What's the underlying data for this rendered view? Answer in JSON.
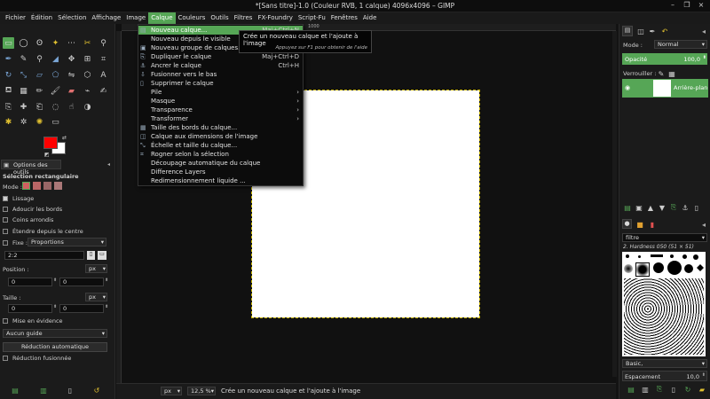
{
  "window": {
    "title": "*[Sans titre]-1.0 (Couleur RVB, 1 calque) 4096x4096 – GIMP",
    "min_glyph": "–",
    "max_glyph": "❐",
    "close_glyph": "×"
  },
  "menubar": [
    "Fichier",
    "Édition",
    "Sélection",
    "Affichage",
    "Image",
    "Calque",
    "Couleurs",
    "Outils",
    "Filtres",
    "FX-Foundry",
    "Script-Fu",
    "Fenêtres",
    "Aide"
  ],
  "menubar_active": "Calque",
  "layer_menu": {
    "items": [
      {
        "label": "Nouveau calque...",
        "shortcut": "Maj+Ctrl+N",
        "icon": "new-layer-icon",
        "highlighted": true
      },
      {
        "label": "Nouveau depuis le visible",
        "shortcut": "",
        "icon": ""
      },
      {
        "label": "Nouveau groupe de calques...",
        "shortcut": "",
        "icon": "layer-group-icon"
      },
      {
        "label": "Dupliquer le calque",
        "shortcut": "Maj+Ctrl+D",
        "icon": "duplicate-icon"
      },
      {
        "label": "Ancrer le calque",
        "shortcut": "Ctrl+H",
        "icon": "anchor-icon"
      },
      {
        "label": "Fusionner vers le bas",
        "shortcut": "",
        "icon": "merge-down-icon"
      },
      {
        "label": "Supprimer le calque",
        "shortcut": "",
        "icon": "delete-icon"
      },
      {
        "label": "Pile",
        "shortcut": "›",
        "icon": ""
      },
      {
        "label": "Masque",
        "shortcut": "›",
        "icon": ""
      },
      {
        "label": "Transparence",
        "shortcut": "›",
        "icon": ""
      },
      {
        "label": "Transformer",
        "shortcut": "›",
        "icon": ""
      },
      {
        "label": "Taille des bords du calque...",
        "shortcut": "",
        "icon": "layer-boundary-icon"
      },
      {
        "label": "Calque aux dimensions de l'image",
        "shortcut": "",
        "icon": "layer-to-image-icon"
      },
      {
        "label": "Échelle et taille du calque...",
        "shortcut": "",
        "icon": "scale-icon"
      },
      {
        "label": "Rogner selon la sélection",
        "shortcut": "",
        "icon": "crop-icon"
      },
      {
        "label": "Découpage automatique du calque",
        "shortcut": "",
        "icon": ""
      },
      {
        "label": "Difference Layers",
        "shortcut": "",
        "icon": ""
      },
      {
        "label": "Redimensionnement liquide ...",
        "shortcut": "",
        "icon": ""
      }
    ]
  },
  "tooltip": {
    "text": "Crée un nouveau calque et l'ajoute à l'image",
    "hint": "Appuyez sur F1 pour obtenir de l'aide"
  },
  "tool_options": {
    "tab_label": "Options des outils",
    "title": "Sélection rectangulaire",
    "mode_label": "Mode :",
    "lissage": "Lissage",
    "adoucir": "Adoucir les bords",
    "coins": "Coins arrondis",
    "etendre": "Étendre depuis le centre",
    "fixe_label": "Fixe :",
    "fixe_value": "Proportions",
    "ratio_value": "2:2",
    "position_label": "Position :",
    "position_unit": "px",
    "pos_x": "0",
    "pos_y": "0",
    "taille_label": "Taille :",
    "taille_unit": "px",
    "size_w": "0",
    "size_h": "0",
    "highlight": "Mise en évidence",
    "guide_value": "Aucun guide",
    "auto_shrink": "Réduction automatique",
    "merged": "Réduction fusionnée"
  },
  "layers_panel": {
    "mode_label": "Mode :",
    "mode_value": "Normal",
    "opacity_label": "Opacité",
    "opacity_value": "100,0",
    "lock_label": "Verrouiller :",
    "layer_name": "Arrière-plan"
  },
  "brushes_panel": {
    "filter_label": "filtre",
    "brush_name": "2. Hardness 050 (51 × 51)",
    "preset": "Basic,",
    "spacing_label": "Espacement",
    "spacing_value": "10,0"
  },
  "status": {
    "unit": "px",
    "zoom": "12,5 %",
    "message": "Crée un nouveau calque et l'ajoute à l'image"
  },
  "ruler_label": "1000",
  "colors": {
    "accent": "#56a656",
    "foreground": "#ff0000",
    "background": "#ffffff"
  }
}
